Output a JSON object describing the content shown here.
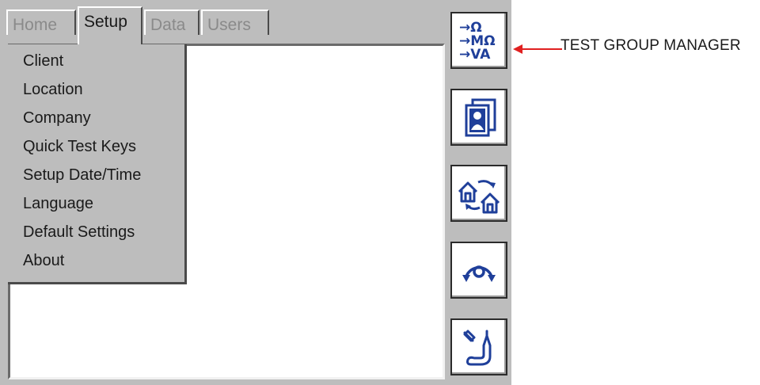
{
  "tabs": [
    {
      "label": "Home",
      "state": "disabled"
    },
    {
      "label": "Setup",
      "state": "active"
    },
    {
      "label": "Data",
      "state": "disabled"
    },
    {
      "label": "Users",
      "state": "disabled"
    }
  ],
  "setup_menu": {
    "items": [
      "Client",
      "Location",
      "Company",
      "Quick Test Keys",
      "Setup Date/Time",
      "Language",
      "Default Settings",
      "About"
    ]
  },
  "side_buttons": {
    "test_group": {
      "icon": "test-group-icon",
      "lines": [
        "→Ω",
        "→MΩ",
        "→VA"
      ]
    },
    "client": {
      "icon": "client-card-icon"
    },
    "location": {
      "icon": "location-transfer-icon"
    },
    "rotate": {
      "icon": "rotate-icon"
    },
    "probe": {
      "icon": "probe-icon"
    }
  },
  "annotation": {
    "label": "TEST GROUP MANAGER",
    "arrow_color": "#e02020"
  },
  "colors": {
    "icon_blue": "#1f3f9a",
    "device_gray": "#bdbdbd"
  }
}
